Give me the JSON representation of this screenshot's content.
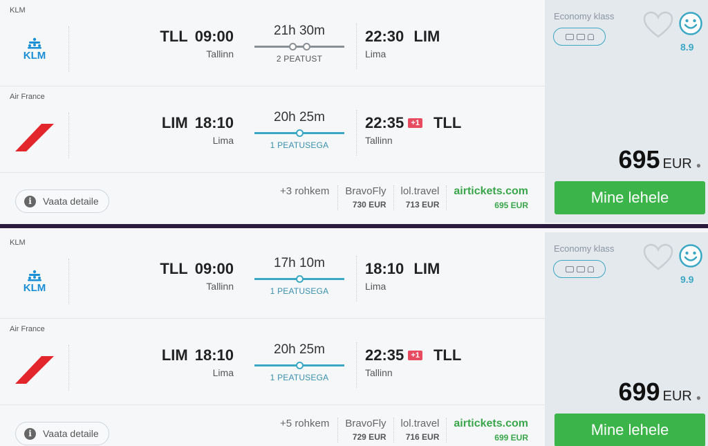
{
  "cards": [
    {
      "legs": [
        {
          "airline": "KLM",
          "logo": "klm",
          "from_code": "TLL",
          "dep_time": "09:00",
          "from_city": "Tallinn",
          "duration": "21h 30m",
          "stops": "2 PEATUST",
          "stop_count": 2,
          "to_code": "LIM",
          "arr_time": "22:30",
          "to_city": "Lima",
          "next_day": ""
        },
        {
          "airline": "Air France",
          "logo": "airfrance",
          "from_code": "LIM",
          "dep_time": "18:10",
          "from_city": "Lima",
          "duration": "20h 25m",
          "stops": "1 PEATUSEGA",
          "stop_count": 1,
          "to_code": "TLL",
          "arr_time": "22:35",
          "to_city": "Tallinn",
          "next_day": "+1"
        }
      ],
      "details_label": "Vaata detaile",
      "more_label": "+3 rohkem",
      "providers": [
        {
          "name": "BravoFly",
          "price": "730 EUR"
        },
        {
          "name": "lol.travel",
          "price": "713 EUR"
        },
        {
          "name": "airtickets.com",
          "price": "695 EUR",
          "best": true
        }
      ],
      "cabin": "Economy klass",
      "score": "8.9",
      "price": "695",
      "currency": "EUR",
      "cta": "Mine lehele"
    },
    {
      "legs": [
        {
          "airline": "KLM",
          "logo": "klm",
          "from_code": "TLL",
          "dep_time": "09:00",
          "from_city": "Tallinn",
          "duration": "17h 10m",
          "stops": "1 PEATUSEGA",
          "stop_count": 1,
          "to_code": "LIM",
          "arr_time": "18:10",
          "to_city": "Lima",
          "next_day": ""
        },
        {
          "airline": "Air France",
          "logo": "airfrance",
          "from_code": "LIM",
          "dep_time": "18:10",
          "from_city": "Lima",
          "duration": "20h 25m",
          "stops": "1 PEATUSEGA",
          "stop_count": 1,
          "to_code": "TLL",
          "arr_time": "22:35",
          "to_city": "Tallinn",
          "next_day": "+1"
        }
      ],
      "details_label": "Vaata detaile",
      "more_label": "+5 rohkem",
      "providers": [
        {
          "name": "BravoFly",
          "price": "729 EUR"
        },
        {
          "name": "lol.travel",
          "price": "716 EUR"
        },
        {
          "name": "airtickets.com",
          "price": "699 EUR",
          "best": true
        }
      ],
      "cabin": "Economy klass",
      "score": "9.9",
      "price": "699",
      "currency": "EUR",
      "cta": "Mine lehele"
    }
  ],
  "colors": {
    "accent": "#3aa7c4",
    "green": "#3bb54a",
    "badge": "#e84a5f"
  },
  "icons": [
    "klm-logo",
    "air-france-logo",
    "info-icon",
    "heart-icon",
    "smiley-icon",
    "person-icon",
    "seat-icon"
  ]
}
